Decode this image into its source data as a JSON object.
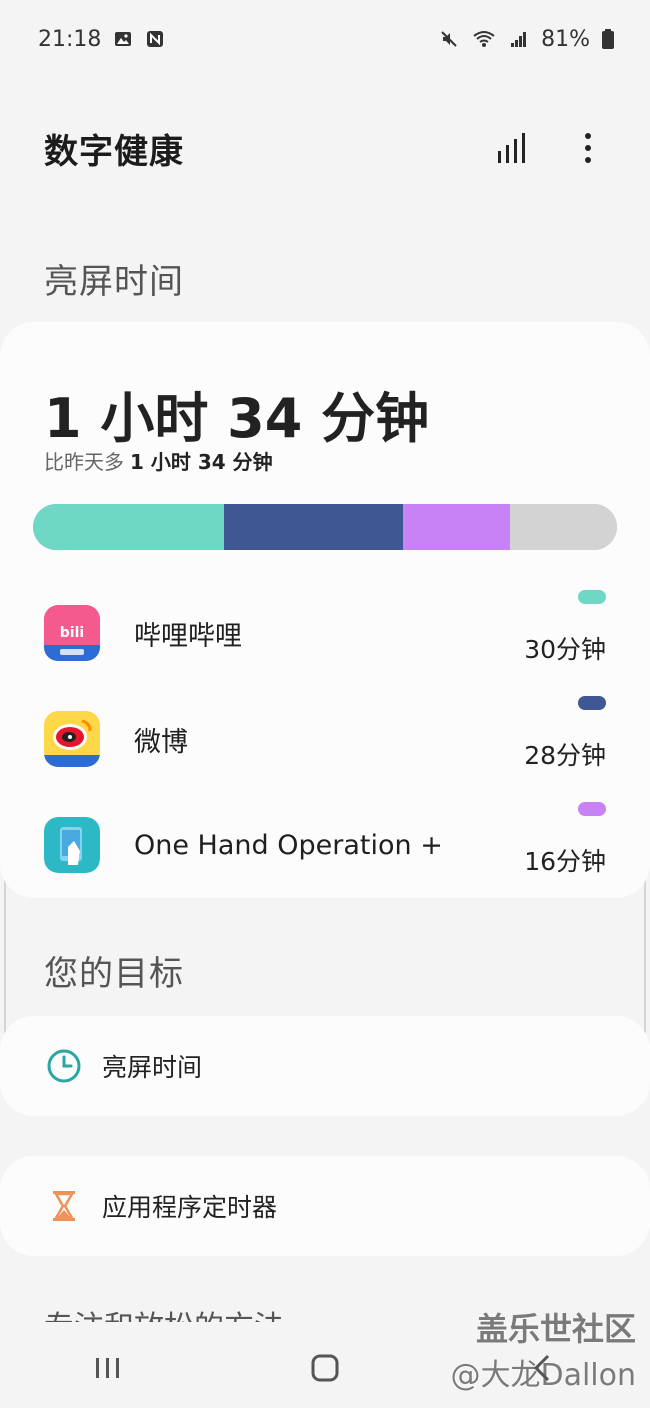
{
  "status_bar": {
    "time": "21:18",
    "battery": "81%"
  },
  "header": {
    "title": "数字健康"
  },
  "screen_time": {
    "section_title": "亮屏时间",
    "total": "1 小时 34 分钟",
    "compare_prefix": "比昨天多",
    "compare_value": "1 小时 34 分钟",
    "usage_fractions": [
      0.327,
      0.307,
      0.182,
      0.184
    ],
    "usage_colors": [
      "#6fd8c5",
      "#3f5793",
      "#c882f6",
      "#d3d3d3"
    ],
    "apps": [
      {
        "name": "哔哩哔哩",
        "time": "30分钟",
        "color": "#6fd8c5",
        "icon": "bilibili-icon"
      },
      {
        "name": "微博",
        "time": "28分钟",
        "color": "#3f5793",
        "icon": "weibo-icon"
      },
      {
        "name": "One Hand Operation +",
        "time": "16分钟",
        "color": "#c882f6",
        "icon": "one-hand-operation-icon"
      }
    ]
  },
  "goals": {
    "section_title": "您的目标",
    "items": [
      {
        "label": "亮屏时间",
        "icon": "clock-icon"
      },
      {
        "label": "应用程序定时器",
        "icon": "hourglass-icon"
      }
    ]
  },
  "next_section_partial": "专注和放松的方法",
  "watermark": {
    "line1": "盖乐世社区",
    "line2": "@大龙Dallon"
  }
}
